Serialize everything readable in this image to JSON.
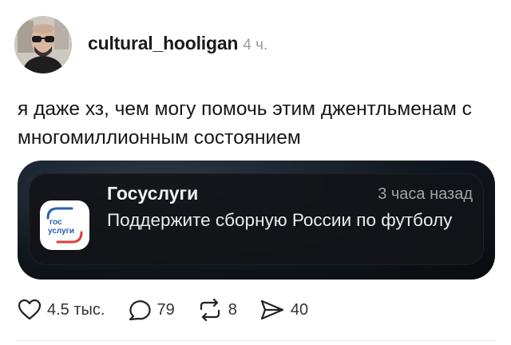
{
  "post": {
    "username": "cultural_hooligan",
    "time": "4 ч.",
    "text": "я даже хз, чем могу помочь этим джентльменам с многомиллионным состоянием"
  },
  "notification": {
    "app_name": "Госуслуги",
    "time": "3 часа назад",
    "body": "Поддержите сборную России по футболу",
    "icon_text_line1": "гос",
    "icon_text_line2": "услуги"
  },
  "actions": {
    "likes": "4.5 тыс.",
    "comments": "79",
    "reposts": "8",
    "shares": "40"
  },
  "icons": {
    "like": "heart-icon",
    "comment": "comment-icon",
    "repost": "repost-icon",
    "share": "share-icon"
  },
  "colors": {
    "gosuslugi_blue": "#2a5fb4",
    "gosuslugi_red": "#e23b3b"
  }
}
